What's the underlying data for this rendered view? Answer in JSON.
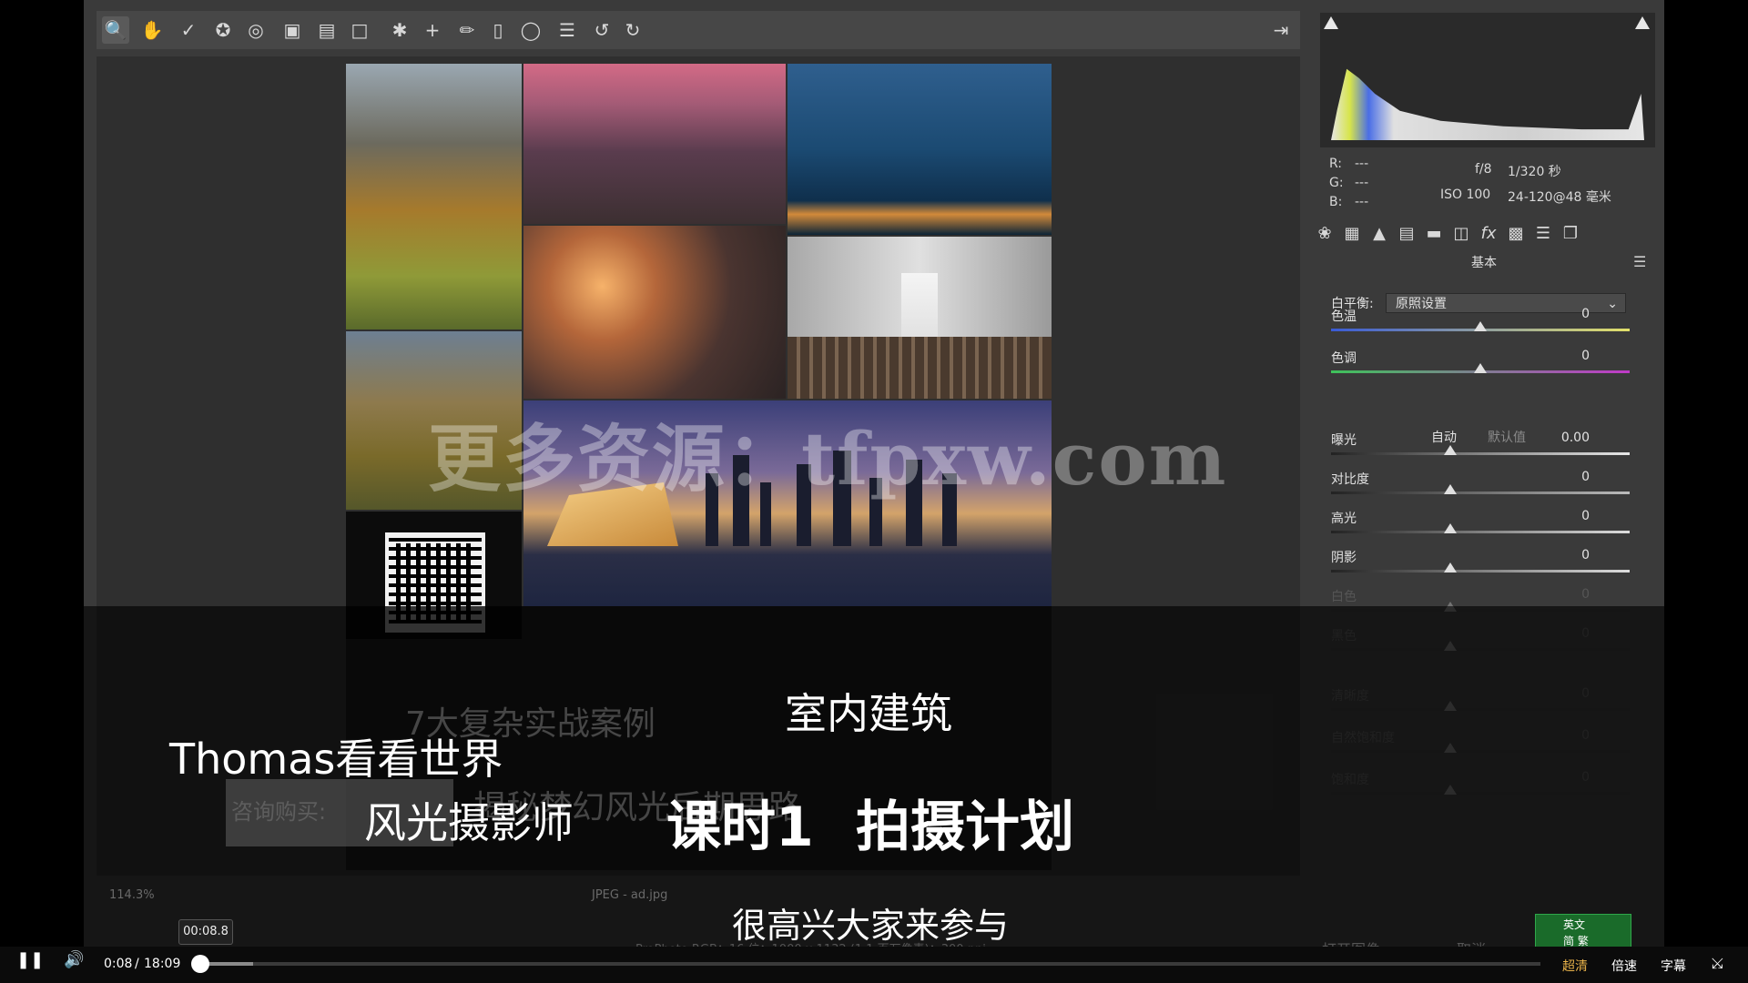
{
  "toolbar": {
    "icons": [
      "zoom-icon",
      "hand-icon",
      "eyedropper-icon",
      "color-sampler-icon",
      "targeted-adjust-icon",
      "crop-icon",
      "straighten-icon",
      "transform-icon",
      "spot-removal-icon",
      "red-eye-icon",
      "adjustment-brush-icon",
      "graduated-filter-icon",
      "radial-filter-icon",
      "preferences-icon",
      "rotate-left-icon",
      "rotate-right-icon"
    ],
    "export_icon": "export-icon"
  },
  "watermark": "更多资源：tfpxw.com",
  "info": {
    "r_label": "R:",
    "r_val": "---",
    "g_label": "G:",
    "g_val": "---",
    "b_label": "B:",
    "b_val": "---",
    "aperture": "f/8",
    "shutter": "1/320 秒",
    "iso": "ISO 100",
    "lens": "24-120@48 毫米"
  },
  "panel": {
    "title": "基本",
    "wb_label": "白平衡:",
    "wb_value": "原照设置",
    "auto": "自动",
    "default": "默认值",
    "sliders": [
      {
        "label": "色温",
        "value": "0"
      },
      {
        "label": "色调",
        "value": "0"
      },
      {
        "label": "曝光",
        "value": "0.00"
      },
      {
        "label": "对比度",
        "value": "0"
      },
      {
        "label": "高光",
        "value": "0"
      },
      {
        "label": "阴影",
        "value": "0"
      },
      {
        "label": "白色",
        "value": "0"
      },
      {
        "label": "黑色",
        "value": "0"
      },
      {
        "label": "清晰度",
        "value": "0"
      },
      {
        "label": "自然饱和度",
        "value": "0"
      },
      {
        "label": "饱和度",
        "value": "0"
      }
    ]
  },
  "overlay": {
    "ghost_cases": "7大复杂实战案例",
    "ghost_consult": "咨询购买:",
    "ghost_line": "揭秘梦幻风光后期思路",
    "category": "室内建筑",
    "author": "Thomas看看世界",
    "author_role": "风光摄影师",
    "lesson": "课时1",
    "lesson_title": "拍摄计划",
    "subtitle": "很高兴大家来参与"
  },
  "status": {
    "zoom": "114.3%",
    "file": "JPEG - ad.jpg",
    "colorspace": "ProPhoto RGB；16 位；1000 x 1132 (1.1 百万像素)；300 ppi",
    "open_image": "打开图像",
    "cancel": "取消"
  },
  "player": {
    "time_current": "0:08",
    "time_sep": "/",
    "time_total": "18:09",
    "tooltip": "00:08.8",
    "quality": "超清",
    "speed": "倍速",
    "subtitles": "字幕",
    "progress_fraction": 0.004
  },
  "ime": {
    "line1": "英文",
    "line2": "简 繁"
  }
}
